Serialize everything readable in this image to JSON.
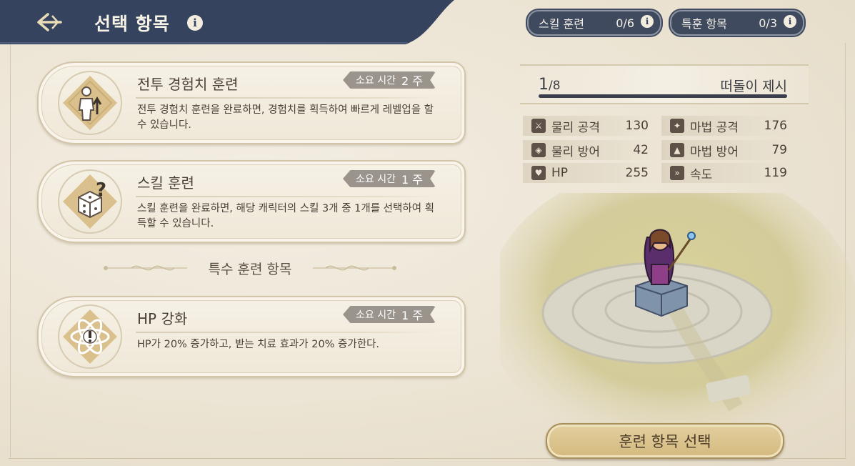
{
  "header": {
    "title": "선택 항목"
  },
  "counters": [
    {
      "label": "스킬 훈련",
      "value": "0/6"
    },
    {
      "label": "특훈 항목",
      "value": "0/3"
    }
  ],
  "cards": [
    {
      "title": "전투 경험치 훈련",
      "time_label": "소요 시간",
      "time_value": "2 주",
      "description": "전투 경험치 훈련을 완료하면, 경험치를 획득하여 빠르게 레벨업을 할 수 있습니다.",
      "icon": "experience-icon"
    },
    {
      "title": "스킬 훈련",
      "time_label": "소요 시간",
      "time_value": "1 주",
      "description": "스킬 훈련을 완료하면, 해당 캐릭터의 스킬 3개 중 1개를 선택하여 획득할 수 있습니다.",
      "icon": "dice-question-icon"
    },
    {
      "title": "HP 강화",
      "time_label": "소요 시간",
      "time_value": "1 주",
      "description": "HP가 20% 증가하고, 받는 치료 효과가 20% 증가한다.",
      "icon": "atom-exclamation-icon"
    }
  ],
  "section_title": "특수 훈련 항목",
  "character": {
    "count": "1",
    "total": "/8",
    "progress": 1.0,
    "name": "떠돌이 제시"
  },
  "stats": [
    {
      "label": "물리 공격",
      "value": "130",
      "icon": "sword-icon"
    },
    {
      "label": "마법 공격",
      "value": "176",
      "icon": "wand-icon"
    },
    {
      "label": "물리 방어",
      "value": "42",
      "icon": "shield-icon"
    },
    {
      "label": "마법 방어",
      "value": "79",
      "icon": "wizard-hat-icon"
    },
    {
      "label": "HP",
      "value": "255",
      "icon": "heart-icon"
    },
    {
      "label": "속도",
      "value": "119",
      "icon": "boot-icon"
    }
  ],
  "select_button": "훈련 항목 선택",
  "colors": {
    "header_bg": "#35435f",
    "paper": "#ece5d6",
    "badge": "#9a948c",
    "button": "#d9c28c"
  }
}
